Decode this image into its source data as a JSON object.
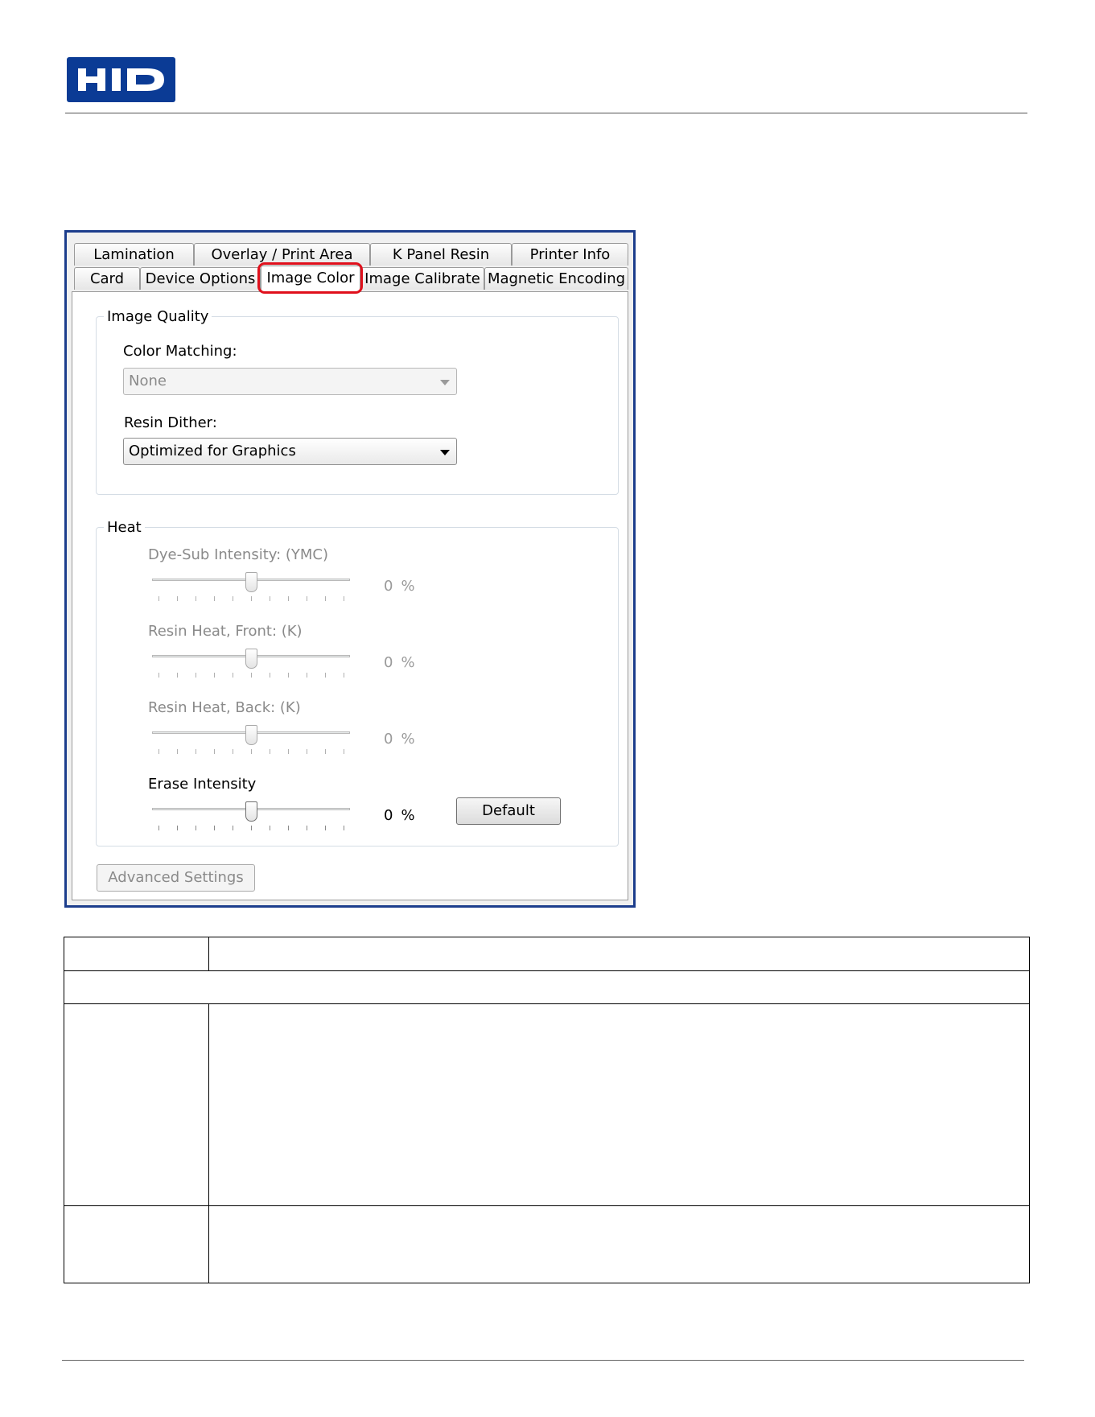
{
  "header": {
    "logo_text": "HID",
    "brand_color": "#0b3b95"
  },
  "dialog": {
    "tabs_row1": [
      "Lamination",
      "Overlay / Print Area",
      "K Panel Resin",
      "Printer Info"
    ],
    "tabs_row2": [
      "Card",
      "Device Options",
      "Image Color",
      "Image Calibrate",
      "Magnetic Encoding"
    ],
    "active_tab": "Image Color",
    "highlight_color": "#e0101c",
    "image_quality": {
      "title": "Image Quality",
      "color_matching_label": "Color Matching:",
      "color_matching_value": "None",
      "resin_dither_label": "Resin Dither:",
      "resin_dither_value": "Optimized for Graphics"
    },
    "heat": {
      "title": "Heat",
      "sliders": [
        {
          "label": "Dye-Sub Intensity: (YMC)",
          "value": "0",
          "unit": "%",
          "level": 0.5,
          "enabled": false
        },
        {
          "label": "Resin Heat, Front: (K)",
          "value": "0",
          "unit": "%",
          "level": 0.5,
          "enabled": false
        },
        {
          "label": "Resin Heat, Back: (K)",
          "value": "0",
          "unit": "%",
          "level": 0.5,
          "enabled": false
        },
        {
          "label": "Erase Intensity",
          "value": "0",
          "unit": "%",
          "level": 0.5,
          "enabled": true
        }
      ],
      "default_button": "Default"
    },
    "advanced_button": "Advanced Settings"
  }
}
